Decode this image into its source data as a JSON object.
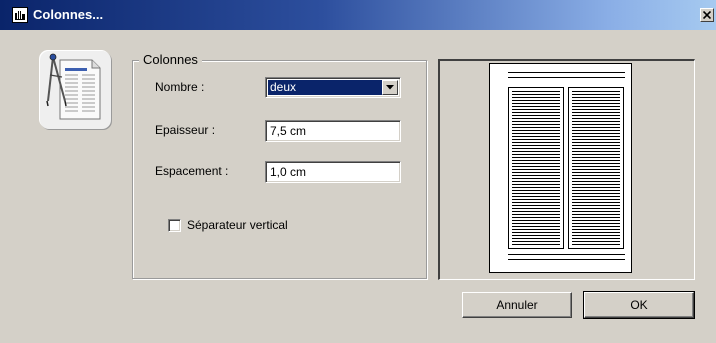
{
  "window": {
    "title": "Colonnes...",
    "app_icon": "app-window-icon",
    "close_icon": "close-icon"
  },
  "side_icon": "document-compass-icon",
  "group": {
    "label": "Colonnes",
    "nombre_label": "Nombre :",
    "nombre_value": "deux",
    "epaisseur_label": "Epaisseur :",
    "epaisseur_value": "7,5 cm",
    "espacement_label": "Espacement :",
    "espacement_value": "1,0 cm",
    "separator_label": "Séparateur vertical",
    "separator_checked": false
  },
  "preview": {
    "columns": 2
  },
  "buttons": {
    "cancel_label": "Annuler",
    "ok_label": "OK"
  },
  "colors": {
    "titlebar_start": "#0a246a",
    "titlebar_end": "#a6caf0",
    "face": "#d4d0c8",
    "selection": "#0a246a"
  }
}
